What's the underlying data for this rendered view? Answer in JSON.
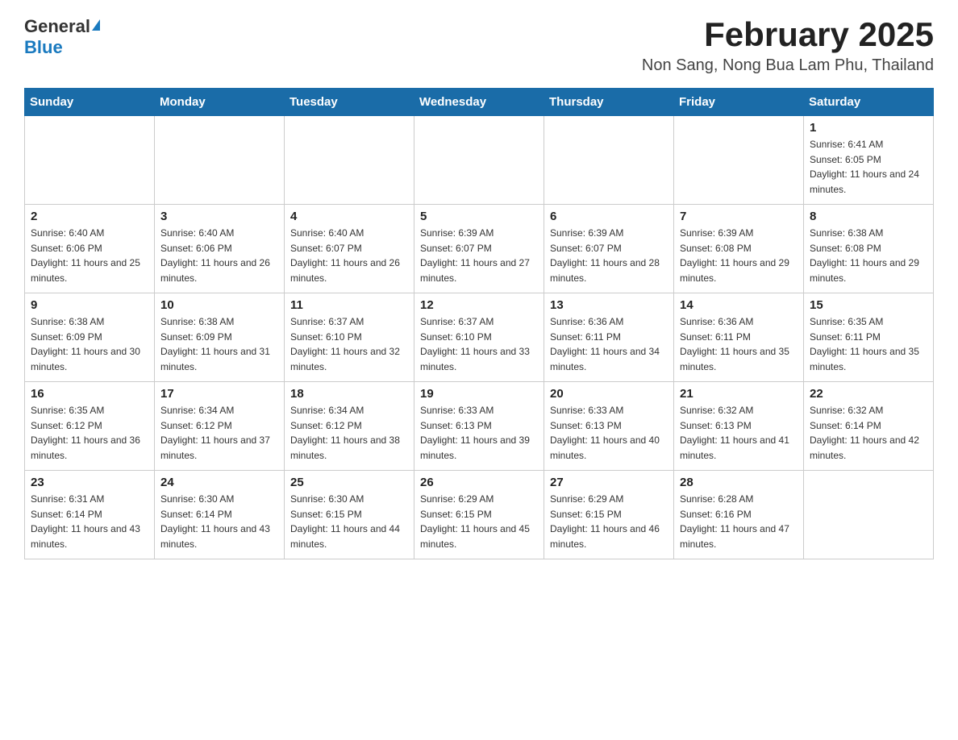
{
  "header": {
    "logo_general": "General",
    "logo_blue": "Blue",
    "month_title": "February 2025",
    "location": "Non Sang, Nong Bua Lam Phu, Thailand"
  },
  "weekdays": [
    "Sunday",
    "Monday",
    "Tuesday",
    "Wednesday",
    "Thursday",
    "Friday",
    "Saturday"
  ],
  "weeks": [
    [
      {
        "day": "",
        "sunrise": "",
        "sunset": "",
        "daylight": ""
      },
      {
        "day": "",
        "sunrise": "",
        "sunset": "",
        "daylight": ""
      },
      {
        "day": "",
        "sunrise": "",
        "sunset": "",
        "daylight": ""
      },
      {
        "day": "",
        "sunrise": "",
        "sunset": "",
        "daylight": ""
      },
      {
        "day": "",
        "sunrise": "",
        "sunset": "",
        "daylight": ""
      },
      {
        "day": "",
        "sunrise": "",
        "sunset": "",
        "daylight": ""
      },
      {
        "day": "1",
        "sunrise": "Sunrise: 6:41 AM",
        "sunset": "Sunset: 6:05 PM",
        "daylight": "Daylight: 11 hours and 24 minutes."
      }
    ],
    [
      {
        "day": "2",
        "sunrise": "Sunrise: 6:40 AM",
        "sunset": "Sunset: 6:06 PM",
        "daylight": "Daylight: 11 hours and 25 minutes."
      },
      {
        "day": "3",
        "sunrise": "Sunrise: 6:40 AM",
        "sunset": "Sunset: 6:06 PM",
        "daylight": "Daylight: 11 hours and 26 minutes."
      },
      {
        "day": "4",
        "sunrise": "Sunrise: 6:40 AM",
        "sunset": "Sunset: 6:07 PM",
        "daylight": "Daylight: 11 hours and 26 minutes."
      },
      {
        "day": "5",
        "sunrise": "Sunrise: 6:39 AM",
        "sunset": "Sunset: 6:07 PM",
        "daylight": "Daylight: 11 hours and 27 minutes."
      },
      {
        "day": "6",
        "sunrise": "Sunrise: 6:39 AM",
        "sunset": "Sunset: 6:07 PM",
        "daylight": "Daylight: 11 hours and 28 minutes."
      },
      {
        "day": "7",
        "sunrise": "Sunrise: 6:39 AM",
        "sunset": "Sunset: 6:08 PM",
        "daylight": "Daylight: 11 hours and 29 minutes."
      },
      {
        "day": "8",
        "sunrise": "Sunrise: 6:38 AM",
        "sunset": "Sunset: 6:08 PM",
        "daylight": "Daylight: 11 hours and 29 minutes."
      }
    ],
    [
      {
        "day": "9",
        "sunrise": "Sunrise: 6:38 AM",
        "sunset": "Sunset: 6:09 PM",
        "daylight": "Daylight: 11 hours and 30 minutes."
      },
      {
        "day": "10",
        "sunrise": "Sunrise: 6:38 AM",
        "sunset": "Sunset: 6:09 PM",
        "daylight": "Daylight: 11 hours and 31 minutes."
      },
      {
        "day": "11",
        "sunrise": "Sunrise: 6:37 AM",
        "sunset": "Sunset: 6:10 PM",
        "daylight": "Daylight: 11 hours and 32 minutes."
      },
      {
        "day": "12",
        "sunrise": "Sunrise: 6:37 AM",
        "sunset": "Sunset: 6:10 PM",
        "daylight": "Daylight: 11 hours and 33 minutes."
      },
      {
        "day": "13",
        "sunrise": "Sunrise: 6:36 AM",
        "sunset": "Sunset: 6:11 PM",
        "daylight": "Daylight: 11 hours and 34 minutes."
      },
      {
        "day": "14",
        "sunrise": "Sunrise: 6:36 AM",
        "sunset": "Sunset: 6:11 PM",
        "daylight": "Daylight: 11 hours and 35 minutes."
      },
      {
        "day": "15",
        "sunrise": "Sunrise: 6:35 AM",
        "sunset": "Sunset: 6:11 PM",
        "daylight": "Daylight: 11 hours and 35 minutes."
      }
    ],
    [
      {
        "day": "16",
        "sunrise": "Sunrise: 6:35 AM",
        "sunset": "Sunset: 6:12 PM",
        "daylight": "Daylight: 11 hours and 36 minutes."
      },
      {
        "day": "17",
        "sunrise": "Sunrise: 6:34 AM",
        "sunset": "Sunset: 6:12 PM",
        "daylight": "Daylight: 11 hours and 37 minutes."
      },
      {
        "day": "18",
        "sunrise": "Sunrise: 6:34 AM",
        "sunset": "Sunset: 6:12 PM",
        "daylight": "Daylight: 11 hours and 38 minutes."
      },
      {
        "day": "19",
        "sunrise": "Sunrise: 6:33 AM",
        "sunset": "Sunset: 6:13 PM",
        "daylight": "Daylight: 11 hours and 39 minutes."
      },
      {
        "day": "20",
        "sunrise": "Sunrise: 6:33 AM",
        "sunset": "Sunset: 6:13 PM",
        "daylight": "Daylight: 11 hours and 40 minutes."
      },
      {
        "day": "21",
        "sunrise": "Sunrise: 6:32 AM",
        "sunset": "Sunset: 6:13 PM",
        "daylight": "Daylight: 11 hours and 41 minutes."
      },
      {
        "day": "22",
        "sunrise": "Sunrise: 6:32 AM",
        "sunset": "Sunset: 6:14 PM",
        "daylight": "Daylight: 11 hours and 42 minutes."
      }
    ],
    [
      {
        "day": "23",
        "sunrise": "Sunrise: 6:31 AM",
        "sunset": "Sunset: 6:14 PM",
        "daylight": "Daylight: 11 hours and 43 minutes."
      },
      {
        "day": "24",
        "sunrise": "Sunrise: 6:30 AM",
        "sunset": "Sunset: 6:14 PM",
        "daylight": "Daylight: 11 hours and 43 minutes."
      },
      {
        "day": "25",
        "sunrise": "Sunrise: 6:30 AM",
        "sunset": "Sunset: 6:15 PM",
        "daylight": "Daylight: 11 hours and 44 minutes."
      },
      {
        "day": "26",
        "sunrise": "Sunrise: 6:29 AM",
        "sunset": "Sunset: 6:15 PM",
        "daylight": "Daylight: 11 hours and 45 minutes."
      },
      {
        "day": "27",
        "sunrise": "Sunrise: 6:29 AM",
        "sunset": "Sunset: 6:15 PM",
        "daylight": "Daylight: 11 hours and 46 minutes."
      },
      {
        "day": "28",
        "sunrise": "Sunrise: 6:28 AM",
        "sunset": "Sunset: 6:16 PM",
        "daylight": "Daylight: 11 hours and 47 minutes."
      },
      {
        "day": "",
        "sunrise": "",
        "sunset": "",
        "daylight": ""
      }
    ]
  ]
}
